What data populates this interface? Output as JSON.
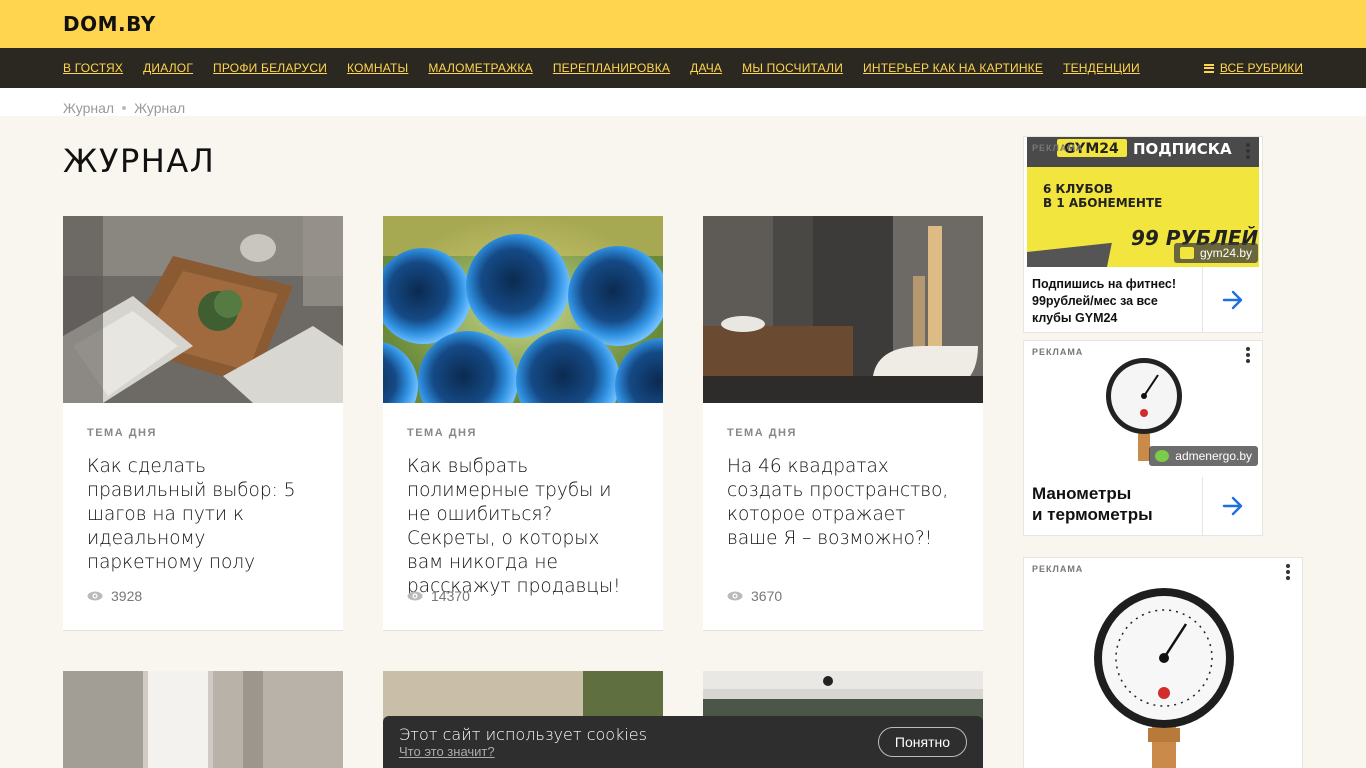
{
  "header": {
    "logo": "DOM.BY"
  },
  "nav": {
    "items": [
      "В ГОСТЯХ",
      "ДИАЛОГ",
      "ПРОФИ БЕЛАРУСИ",
      "КОМНАТЫ",
      "МАЛОМЕТРАЖКА",
      "ПЕРЕПЛАНИРОВКА",
      "ДАЧА",
      "МЫ ПОСЧИТАЛИ",
      "ИНТЕРЬЕР КАК НА КАРТИНКЕ",
      "ТЕНДЕНЦИИ"
    ],
    "all_label": "ВСЕ РУБРИКИ"
  },
  "breadcrumb": [
    "Журнал",
    "Журнал"
  ],
  "page_title": "ЖУРНАЛ",
  "cards": [
    {
      "tag": "ТЕМА ДНЯ",
      "title": "Как сделать правильный выбор: 5 шагов на пути к идеальному паркетному полу",
      "views": "3928"
    },
    {
      "tag": "ТЕМА ДНЯ",
      "title": "Как выбрать полимерные трубы и не ошибиться? Секреты, о которых вам никогда не расскажут продавцы!",
      "views": "14370"
    },
    {
      "tag": "ТЕМА ДНЯ",
      "title": "На 46 квадратах создать пространство, которое отражает ваше Я – возможно?!",
      "views": "3670"
    }
  ],
  "ads": [
    {
      "label": "РЕКЛАМА",
      "banner_brand": "GYM24",
      "banner_headline": "ПОДПИСКА",
      "banner_line1": "6 КЛУБОВ",
      "banner_line2": "В 1 АБОНЕМЕНТЕ",
      "banner_price": "99 РУБЛЕЙ",
      "domain": "gym24.by",
      "text": "Подпишись на фитнес! 99рублей/мес за все клубы GYM24"
    },
    {
      "label": "РЕКЛАМА",
      "domain": "admenergo.by",
      "text_line1": "Манометры",
      "text_line2": "и термометры"
    },
    {
      "label": "РЕКЛАМА"
    }
  ],
  "cookie": {
    "message": "Этот сайт использует cookies",
    "link": "Что это значит?",
    "button": "Понятно"
  },
  "colors": {
    "brand_yellow": "#ffd54f",
    "nav_dark": "#2a2820",
    "page_bg": "#f8f6ef",
    "arrow_blue": "#1e6fe0"
  }
}
